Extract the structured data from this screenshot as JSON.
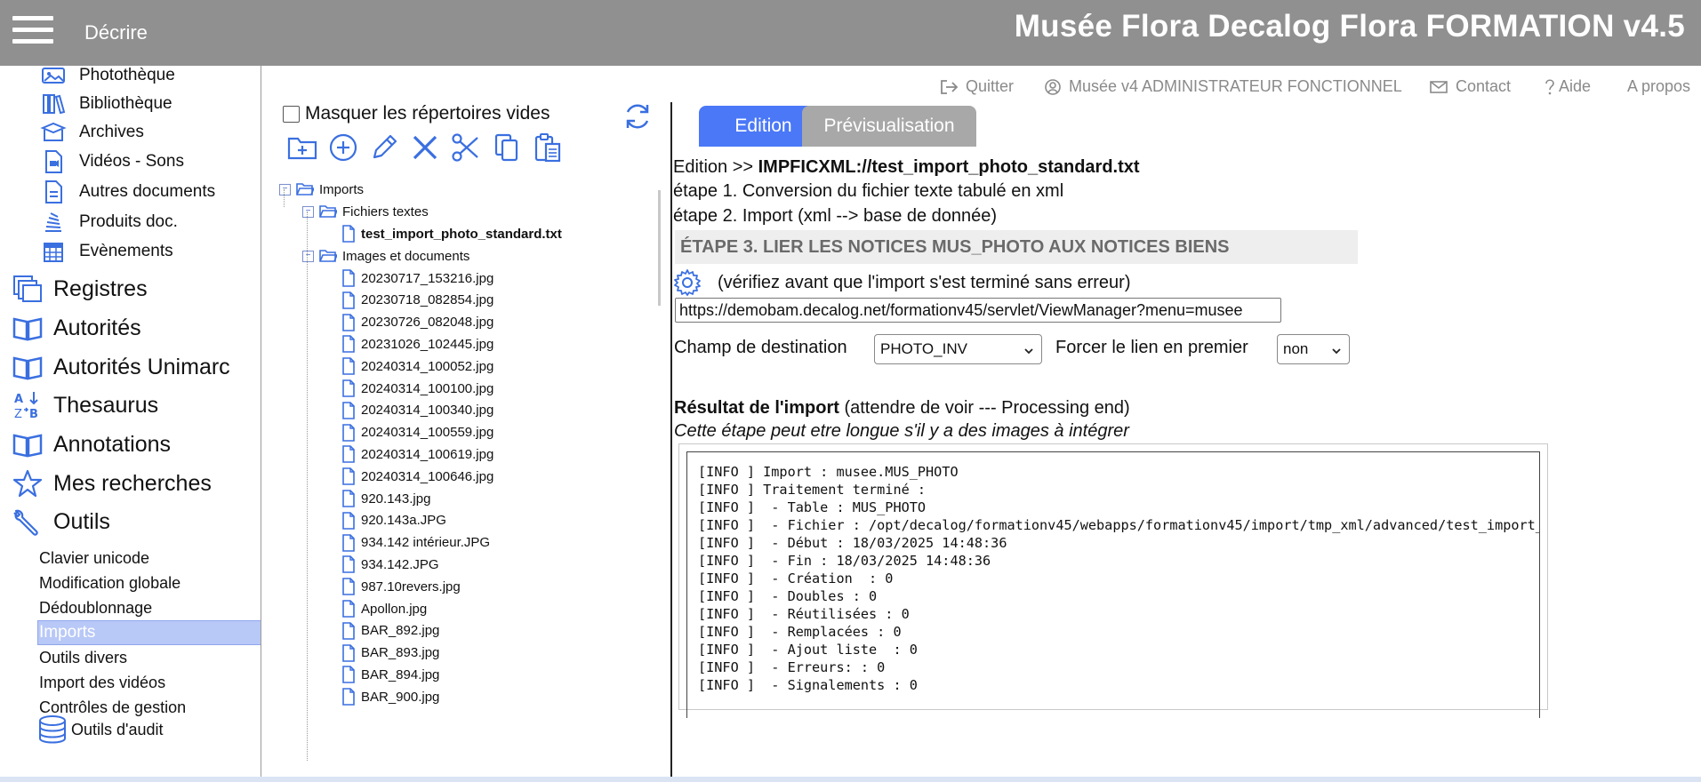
{
  "header": {
    "menu_label": "Décrire",
    "app_title": "Musée Flora Decalog Flora FORMATION v4.5"
  },
  "sidebar": {
    "sub_items": [
      {
        "label": "Photothèque",
        "icon": "photo-icon"
      },
      {
        "label": "Bibliothèque",
        "icon": "books-icon"
      },
      {
        "label": "Archives",
        "icon": "archive-box-icon"
      },
      {
        "label": "Vidéos - Sons",
        "icon": "video-file-icon"
      },
      {
        "label": "Autres documents",
        "icon": "document-icon"
      },
      {
        "label": "Produits doc.",
        "icon": "stack-icon"
      },
      {
        "label": "Evènements",
        "icon": "calendar-icon"
      }
    ],
    "main_items": [
      {
        "label": "Registres",
        "icon": "registers-icon"
      },
      {
        "label": "Autorités",
        "icon": "open-book-icon"
      },
      {
        "label": "Autorités Unimarc",
        "icon": "open-book-icon"
      },
      {
        "label": "Thesaurus",
        "icon": "sort-az-icon"
      },
      {
        "label": "Annotations",
        "icon": "open-book-icon"
      },
      {
        "label": "Mes recherches",
        "icon": "star-icon"
      },
      {
        "label": "Outils",
        "icon": "wrench-icon"
      }
    ],
    "tools": [
      "Clavier unicode",
      "Modification globale",
      "Dédoublonnage",
      "Imports",
      "Outils divers",
      "Import des vidéos",
      "Contrôles de gestion"
    ],
    "audit_label": "Outils d'audit",
    "active_tool": "Imports"
  },
  "tree_panel": {
    "mask_label": "Masquer les répertoires vides",
    "mask_checked": false,
    "toolbar_icons": [
      "new-folder-icon",
      "add-circle-icon",
      "edit-pencil-icon",
      "delete-x-icon",
      "cut-scissors-icon",
      "copy-icon",
      "paste-icon"
    ],
    "root": "Imports",
    "folder1": "Fichiers textes",
    "file_selected": "test_import_photo_standard.txt",
    "folder2": "Images et documents",
    "files": [
      "20230717_153216.jpg",
      "20230718_082854.jpg",
      "20230726_082048.jpg",
      "20231026_102445.jpg",
      "20240314_100052.jpg",
      "20240314_100100.jpg",
      "20240314_100340.jpg",
      "20240314_100559.jpg",
      "20240314_100619.jpg",
      "20240314_100646.jpg",
      "920.143.jpg",
      "920.143a.JPG",
      "934.142 intérieur.JPG",
      "934.142.JPG",
      "987.10revers.jpg",
      "Apollon.jpg",
      "BAR_892.jpg",
      "BAR_893.jpg",
      "BAR_894.jpg",
      "BAR_900.jpg"
    ]
  },
  "top_links": {
    "quit": "Quitter",
    "user": "Musée v4 ADMINISTRATEUR FONCTIONNEL",
    "contact": "Contact",
    "help": "Aide",
    "about": "A propos"
  },
  "tabs": {
    "edition": "Edition",
    "preview": "Prévisualisation"
  },
  "content": {
    "breadcrumb_prefix": "Edition >> ",
    "breadcrumb_path": "IMPFICXML://test_import_photo_standard.txt",
    "step1": "étape 1. Conversion du fichier texte tabulé en xml",
    "step2": "étape 2. Import (xml --> base de donnée)",
    "step3": "ÉTAPE 3. LIER LES NOTICES MUS_PHOTO AUX NOTICES BIENS",
    "check_note": "(vérifiez avant que l'import s'est terminé sans erreur)",
    "url_value": "https://demobam.decalog.net/formationv45/servlet/ViewManager?menu=musee",
    "dest_label": "Champ de destination",
    "dest_value": "PHOTO_INV",
    "force_label": "Forcer le lien en premier",
    "force_value": "non",
    "result_title": "Résultat de l'import",
    "result_note": " (attendre de voir --- Processing end)",
    "long_note": "Cette étape peut etre longue s'il y a des images à intégrer",
    "log": "[INFO ] Import : musee.MUS_PHOTO\n[INFO ] Traitement terminé :\n[INFO ]  - Table : MUS_PHOTO\n[INFO ]  - Fichier : /opt/decalog/formationv45/webapps/formationv45/import/tmp_xml/advanced/test_import_photo_standard.xml\n[INFO ]  - Début : 18/03/2025 14:48:36\n[INFO ]  - Fin : 18/03/2025 14:48:36\n[INFO ]  - Création  : 0\n[INFO ]  - Doubles : 0\n[INFO ]  - Réutilisées : 0\n[INFO ]  - Remplacées : 0\n[INFO ]  - Ajout liste  : 0\n[INFO ]  - Erreurs: : 0\n[INFO ]  - Signalements : 0"
  },
  "colors": {
    "header_bg": "#909090",
    "accent_blue": "#4a78f7",
    "icon_blue": "#3a6fe0",
    "active_tool_bg": "#b8c8f7"
  }
}
